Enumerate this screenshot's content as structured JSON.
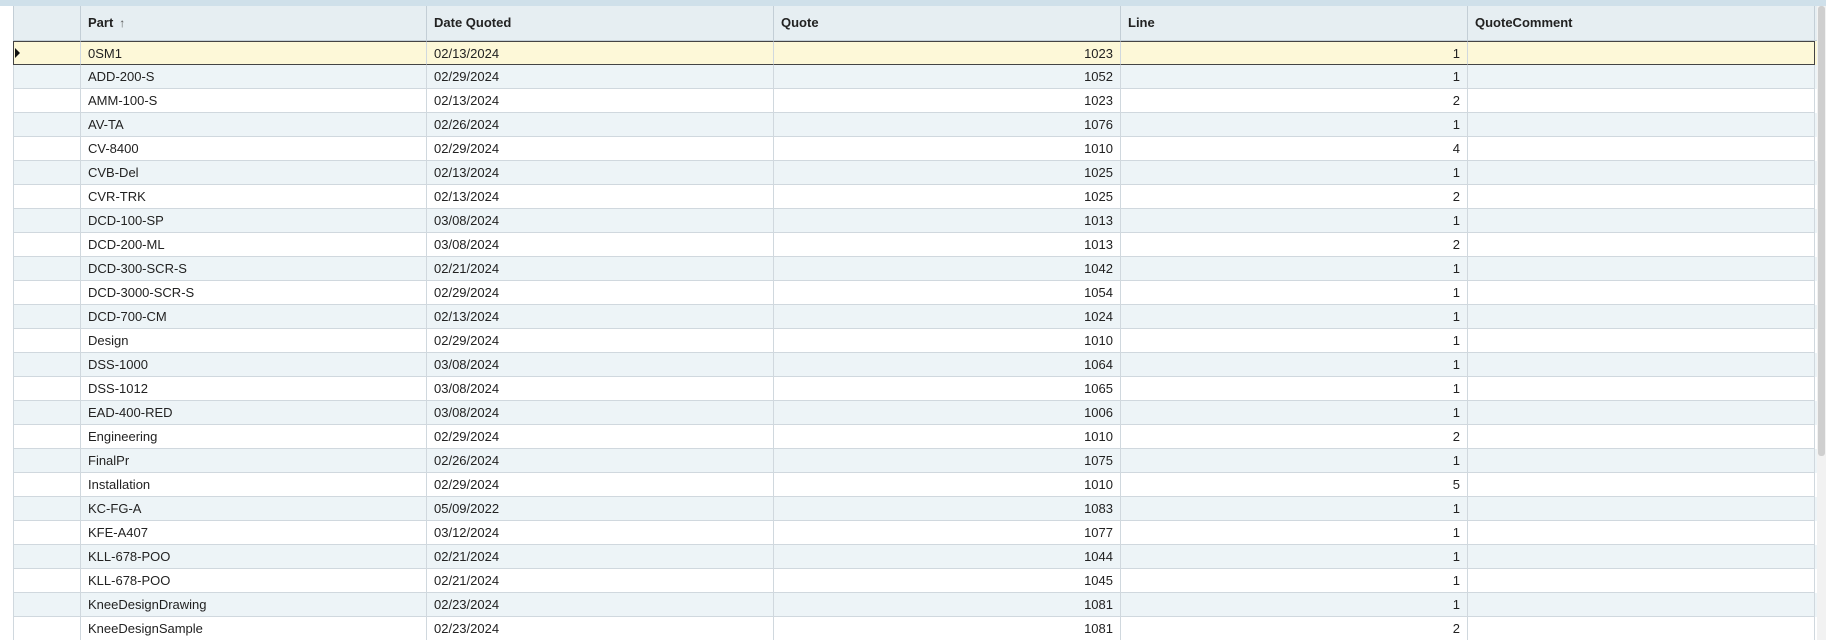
{
  "grid": {
    "columns": [
      {
        "label": ""
      },
      {
        "label": "Part",
        "sort_icon": "↑"
      },
      {
        "label": "Date Quoted"
      },
      {
        "label": "Quote"
      },
      {
        "label": "Line"
      },
      {
        "label": "QuoteComment"
      }
    ],
    "sort": {
      "column": "Part",
      "direction": "ascending",
      "icon": "sort-ascending-arrow-icon"
    },
    "current_row_index": 0,
    "vertical_scroll_position": 0.0,
    "rows": [
      {
        "part": "0SM1",
        "date": "02/13/2024",
        "quote": "1023",
        "line": "1",
        "comment": ""
      },
      {
        "part": "ADD-200-S",
        "date": "02/29/2024",
        "quote": "1052",
        "line": "1",
        "comment": ""
      },
      {
        "part": "AMM-100-S",
        "date": "02/13/2024",
        "quote": "1023",
        "line": "2",
        "comment": ""
      },
      {
        "part": "AV-TA",
        "date": "02/26/2024",
        "quote": "1076",
        "line": "1",
        "comment": ""
      },
      {
        "part": "CV-8400",
        "date": "02/29/2024",
        "quote": "1010",
        "line": "4",
        "comment": ""
      },
      {
        "part": "CVB-Del",
        "date": "02/13/2024",
        "quote": "1025",
        "line": "1",
        "comment": ""
      },
      {
        "part": "CVR-TRK",
        "date": "02/13/2024",
        "quote": "1025",
        "line": "2",
        "comment": ""
      },
      {
        "part": "DCD-100-SP",
        "date": "03/08/2024",
        "quote": "1013",
        "line": "1",
        "comment": ""
      },
      {
        "part": "DCD-200-ML",
        "date": "03/08/2024",
        "quote": "1013",
        "line": "2",
        "comment": ""
      },
      {
        "part": "DCD-300-SCR-S",
        "date": "02/21/2024",
        "quote": "1042",
        "line": "1",
        "comment": ""
      },
      {
        "part": "DCD-3000-SCR-S",
        "date": "02/29/2024",
        "quote": "1054",
        "line": "1",
        "comment": ""
      },
      {
        "part": "DCD-700-CM",
        "date": "02/13/2024",
        "quote": "1024",
        "line": "1",
        "comment": ""
      },
      {
        "part": "Design",
        "date": "02/29/2024",
        "quote": "1010",
        "line": "1",
        "comment": ""
      },
      {
        "part": "DSS-1000",
        "date": "03/08/2024",
        "quote": "1064",
        "line": "1",
        "comment": ""
      },
      {
        "part": "DSS-1012",
        "date": "03/08/2024",
        "quote": "1065",
        "line": "1",
        "comment": ""
      },
      {
        "part": "EAD-400-RED",
        "date": "03/08/2024",
        "quote": "1006",
        "line": "1",
        "comment": ""
      },
      {
        "part": "Engineering",
        "date": "02/29/2024",
        "quote": "1010",
        "line": "2",
        "comment": ""
      },
      {
        "part": "FinalPr",
        "date": "02/26/2024",
        "quote": "1075",
        "line": "1",
        "comment": ""
      },
      {
        "part": "Installation",
        "date": "02/29/2024",
        "quote": "1010",
        "line": "5",
        "comment": ""
      },
      {
        "part": "KC-FG-A",
        "date": "05/09/2022",
        "quote": "1083",
        "line": "1",
        "comment": ""
      },
      {
        "part": "KFE-A407",
        "date": "03/12/2024",
        "quote": "1077",
        "line": "1",
        "comment": ""
      },
      {
        "part": "KLL-678-POO",
        "date": "02/21/2024",
        "quote": "1044",
        "line": "1",
        "comment": ""
      },
      {
        "part": "KLL-678-POO",
        "date": "02/21/2024",
        "quote": "1045",
        "line": "1",
        "comment": ""
      },
      {
        "part": "KneeDesignDrawing",
        "date": "02/23/2024",
        "quote": "1081",
        "line": "1",
        "comment": ""
      },
      {
        "part": "KneeDesignSample",
        "date": "02/23/2024",
        "quote": "1081",
        "line": "2",
        "comment": ""
      }
    ]
  },
  "colors": {
    "header_bg": "#e6eef2",
    "row_alt_bg": "#edf4f7",
    "row_current_bg": "#fdf8d8",
    "gridline": "#d0d8de"
  }
}
